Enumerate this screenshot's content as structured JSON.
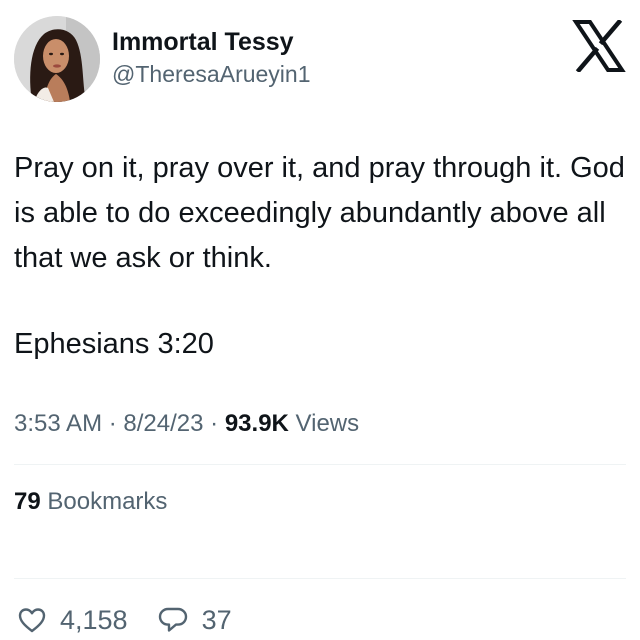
{
  "user": {
    "display_name": "Immortal Tessy",
    "handle": "@TheresaArueyin1"
  },
  "tweet": {
    "paragraphs": [
      "Pray on it, pray over it, and pray through it. God is able to do exceedingly abundantly above all that we ask or think.",
      "Ephesians 3:20"
    ]
  },
  "meta": {
    "time": "3:53 AM",
    "date": "8/24/23",
    "separator": "·",
    "views_count": "93.9K",
    "views_label": "Views"
  },
  "bookmarks": {
    "count": "79",
    "label": "Bookmarks"
  },
  "actions": {
    "likes_count": "4,158",
    "replies_count": "37"
  },
  "icons": {
    "logo": "x-logo-icon",
    "like": "heart-icon",
    "reply": "comment-icon"
  },
  "colors": {
    "text_primary": "#0f1419",
    "text_secondary": "#536471",
    "divider": "#eff3f4",
    "background": "#ffffff"
  }
}
